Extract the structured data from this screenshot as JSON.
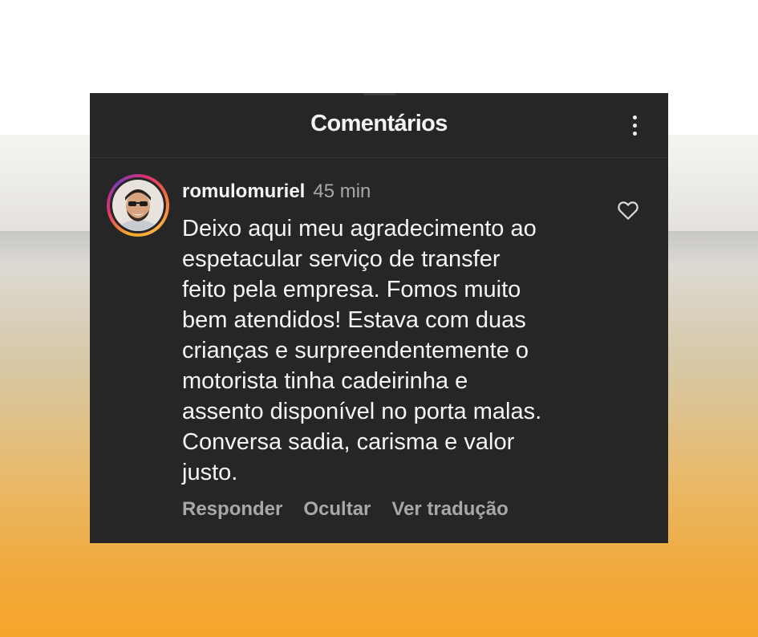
{
  "panel": {
    "title": "Comentários"
  },
  "comment": {
    "username": "romulomuriel",
    "time": "45 min",
    "text": "Deixo aqui meu agradecimento ao\nespetacular serviço de transfer\nfeito pela empresa. Fomos muito\nbem atendidos! Estava com duas\ncrianças e surpreendentemente o\nmotorista tinha cadeirinha e\nassento disponível no porta malas.\nConversa sadia, carisma e valor\njusto."
  },
  "actions": {
    "reply": "Responder",
    "hide": "Ocultar",
    "translate": "Ver tradução"
  },
  "icons": {
    "more": "more-vertical-icon",
    "like": "heart-outline-icon"
  },
  "colors": {
    "panel_background": "#262626",
    "text_primary": "#f5f5f5",
    "text_secondary": "#a8a8a8",
    "background_accent": "#f5a52c"
  }
}
